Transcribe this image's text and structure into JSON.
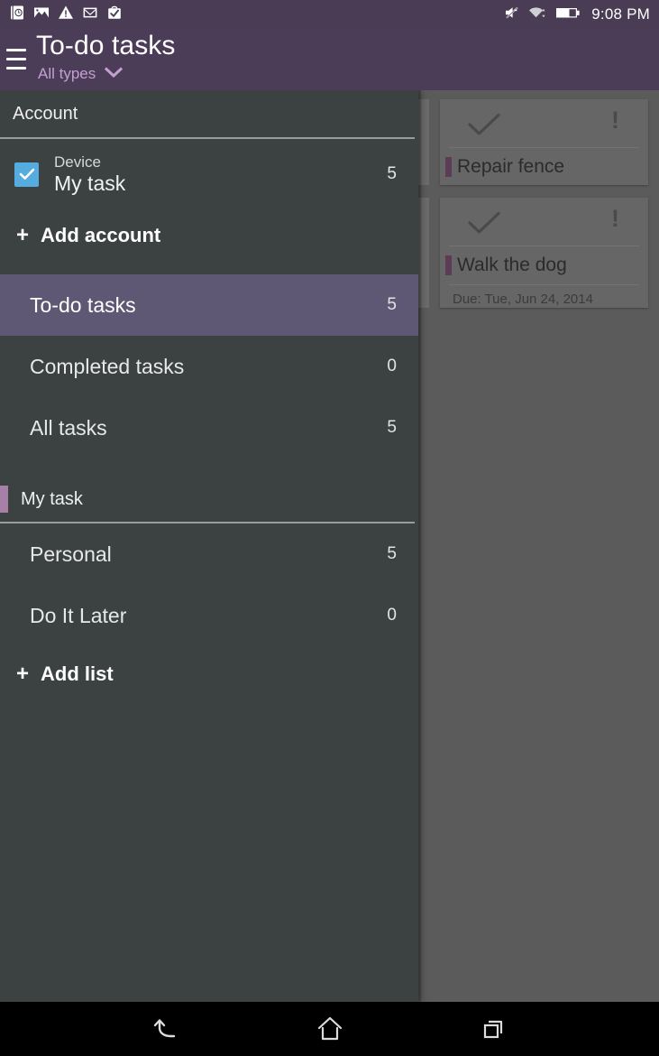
{
  "status_bar": {
    "icons": [
      "alarm-clock-icon",
      "photo-icon",
      "warning-icon",
      "mail-icon",
      "task-check-icon"
    ],
    "right_icons": [
      "mute-icon",
      "wifi-icon",
      "battery-icon"
    ],
    "clock": "9:08 PM"
  },
  "app_bar": {
    "menu_icon": "hamburger-menu-icon",
    "title": "To-do tasks",
    "filter_label": "All types",
    "filter_caret_icon": "chevron-down-icon",
    "background_color": "#4b3d58"
  },
  "drawer": {
    "account_section": {
      "header": "Account",
      "account": {
        "checkbox_checked": true,
        "subtitle": "Device",
        "name": "My task",
        "count": "5"
      },
      "add_account_label": "Add account",
      "add_plus": "+"
    },
    "nav_items": [
      {
        "label": "To-do tasks",
        "count": "5",
        "selected": true
      },
      {
        "label": "Completed tasks",
        "count": "0",
        "selected": false
      },
      {
        "label": "All tasks",
        "count": "5",
        "selected": false
      }
    ],
    "list_section": {
      "header": "My task",
      "accent_color": "#a87fa8",
      "lists": [
        {
          "label": "Personal",
          "count": "5"
        },
        {
          "label": "Do It Later",
          "count": "0"
        }
      ],
      "add_list_label": "Add list",
      "add_plus": "+"
    },
    "background_color": "#3c4242",
    "selected_color": "#5f5874",
    "checkbox_color": "#55acdf"
  },
  "task_cards": [
    {
      "complete_icon": "checkmark-icon",
      "priority_icon": "exclamation-icon",
      "accent_color": "#5b3b55",
      "title": "Repair fence",
      "due": ""
    },
    {
      "complete_icon": "checkmark-icon",
      "priority_icon": "exclamation-icon",
      "accent_color": "#5b3b55",
      "title": "Walk the dog",
      "due": "Due: Tue, Jun 24, 2014"
    }
  ],
  "nav_bar": {
    "back_icon": "back-arrow-icon",
    "home_icon": "home-icon",
    "recents_icon": "recent-apps-icon"
  }
}
